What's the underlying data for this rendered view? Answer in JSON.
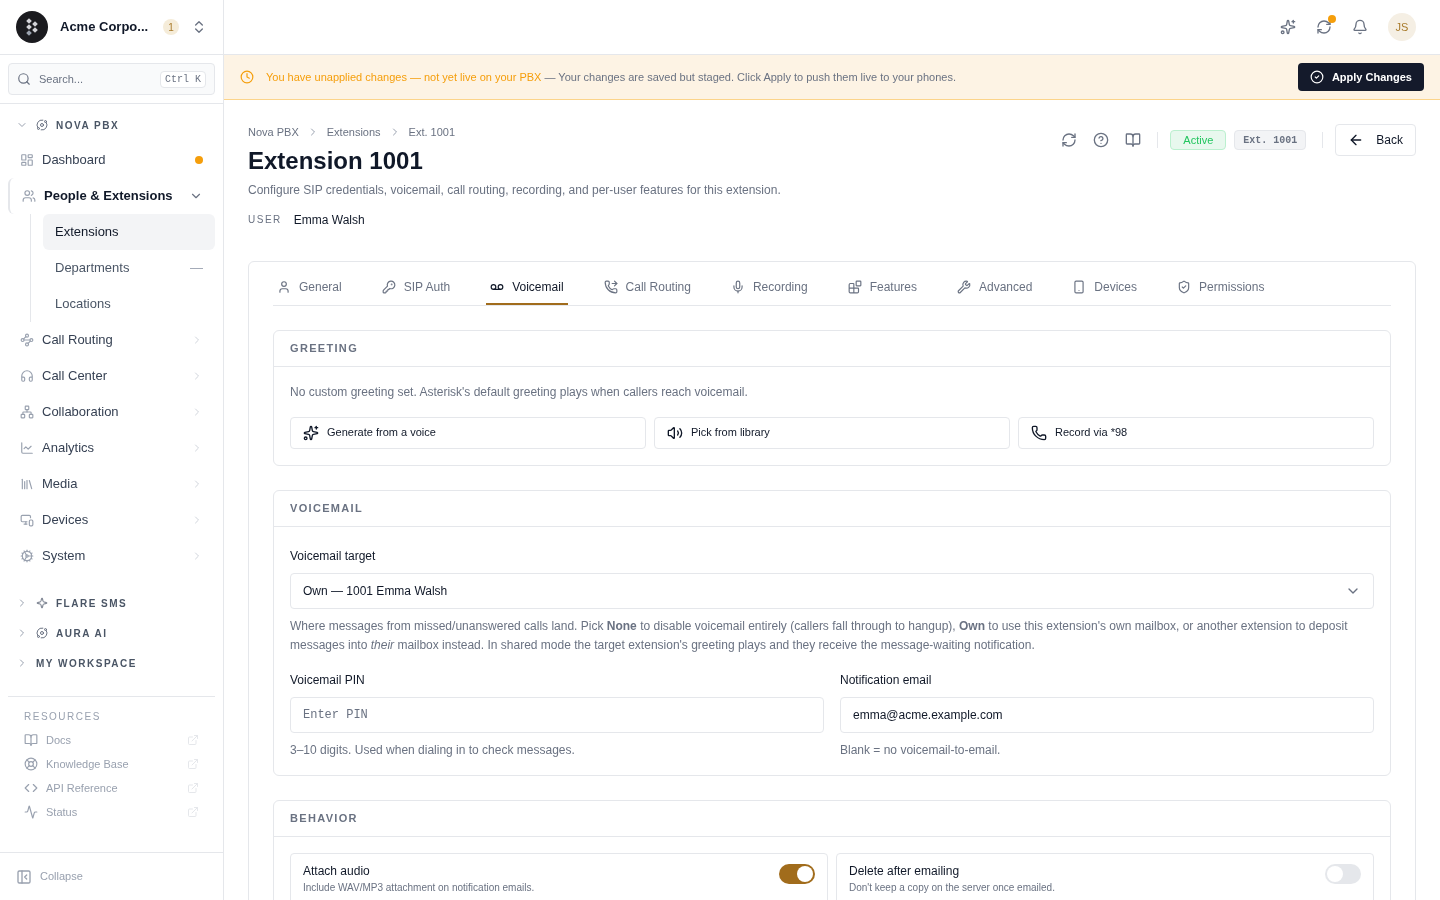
{
  "org": {
    "name": "Acme Corpo...",
    "count": "1"
  },
  "search": {
    "placeholder": "Search...",
    "shortcut": "Ctrl K"
  },
  "sections": [
    {
      "title": "NOVA PBX",
      "expanded": true,
      "items": [
        {
          "label": "Dashboard",
          "alert": true
        },
        {
          "label": "People & Extensions",
          "expanded": true,
          "children": [
            {
              "label": "Extensions",
              "selected": true
            },
            {
              "label": "Departments",
              "selected": false,
              "suffix": "—"
            },
            {
              "label": "Locations",
              "selected": false
            }
          ]
        },
        {
          "label": "Call Routing",
          "expanded": false
        },
        {
          "label": "Call Center",
          "expanded": false
        },
        {
          "label": "Collaboration",
          "expanded": false
        },
        {
          "label": "Analytics",
          "expanded": false
        },
        {
          "label": "Media",
          "expanded": false
        },
        {
          "label": "Devices",
          "expanded": false
        },
        {
          "label": "System",
          "expanded": false
        }
      ]
    },
    {
      "title": "FLARE SMS",
      "expanded": false
    },
    {
      "title": "AURA AI",
      "expanded": false
    },
    {
      "title": "MY WORKSPACE",
      "expanded": false
    }
  ],
  "resources": {
    "title": "RESOURCES",
    "links": [
      "Docs",
      "Knowledge Base",
      "API Reference",
      "Status"
    ]
  },
  "collapse": "Collapse",
  "topbar": {
    "sync_pending": true,
    "avatar": "JS"
  },
  "banner": {
    "highlight": "You have unapplied changes — not yet live on your PBX",
    "text": "— Your changes are saved but staged. Click Apply to push them live to your phones.",
    "button": "Apply Changes"
  },
  "breadcrumbs": [
    "Nova PBX",
    "Extensions",
    "Ext. 1001"
  ],
  "title": "Extension 1001",
  "subtitle": "Configure SIP credentials, voicemail, call routing, recording, and per-user features for this extension.",
  "user": {
    "label": "USER",
    "value": "Emma Walsh"
  },
  "status": {
    "label": "Active",
    "ext": "Ext. 1001",
    "back": "Back"
  },
  "tabs": [
    {
      "label": "General",
      "selected": false
    },
    {
      "label": "SIP Auth",
      "selected": false
    },
    {
      "label": "Voicemail",
      "selected": true
    },
    {
      "label": "Call Routing",
      "selected": false
    },
    {
      "label": "Recording",
      "selected": false
    },
    {
      "label": "Features",
      "selected": false
    },
    {
      "label": "Advanced",
      "selected": false
    },
    {
      "label": "Devices",
      "selected": false
    },
    {
      "label": "Permissions",
      "selected": false
    }
  ],
  "greeting": {
    "title": "GREETING",
    "text": "No custom greeting set. Asterisk's default greeting plays when callers reach voicemail.",
    "buttons": [
      "Generate from a voice",
      "Pick from library",
      "Record via *98"
    ]
  },
  "voicemail": {
    "title": "VOICEMAIL",
    "target_label": "Voicemail target",
    "target_value": "Own — 1001 Emma Walsh",
    "help": "Where messages from missed/unanswered calls land. Pick **None** to disable voicemail entirely (callers fall through to hangup), **Own** to use this extension's own mailbox, or another extension to deposit messages into *their* mailbox instead. In shared mode the target extension's greeting plays and they receive the message-waiting notification.",
    "pin": {
      "label": "Voicemail PIN",
      "placeholder": "Enter PIN",
      "hint": "3–10 digits. Used when dialing in to check messages."
    },
    "email": {
      "label": "Notification email",
      "value": "emma@acme.example.com",
      "hint": "Blank = no voicemail-to-email."
    }
  },
  "behavior": {
    "title": "BEHAVIOR",
    "toggles": [
      {
        "label": "Attach audio",
        "description": "Include WAV/MP3 attachment on notification emails.",
        "on": true
      },
      {
        "label": "Delete after emailing",
        "description": "Don't keep a copy on the server once emailed.",
        "on": false
      }
    ]
  }
}
